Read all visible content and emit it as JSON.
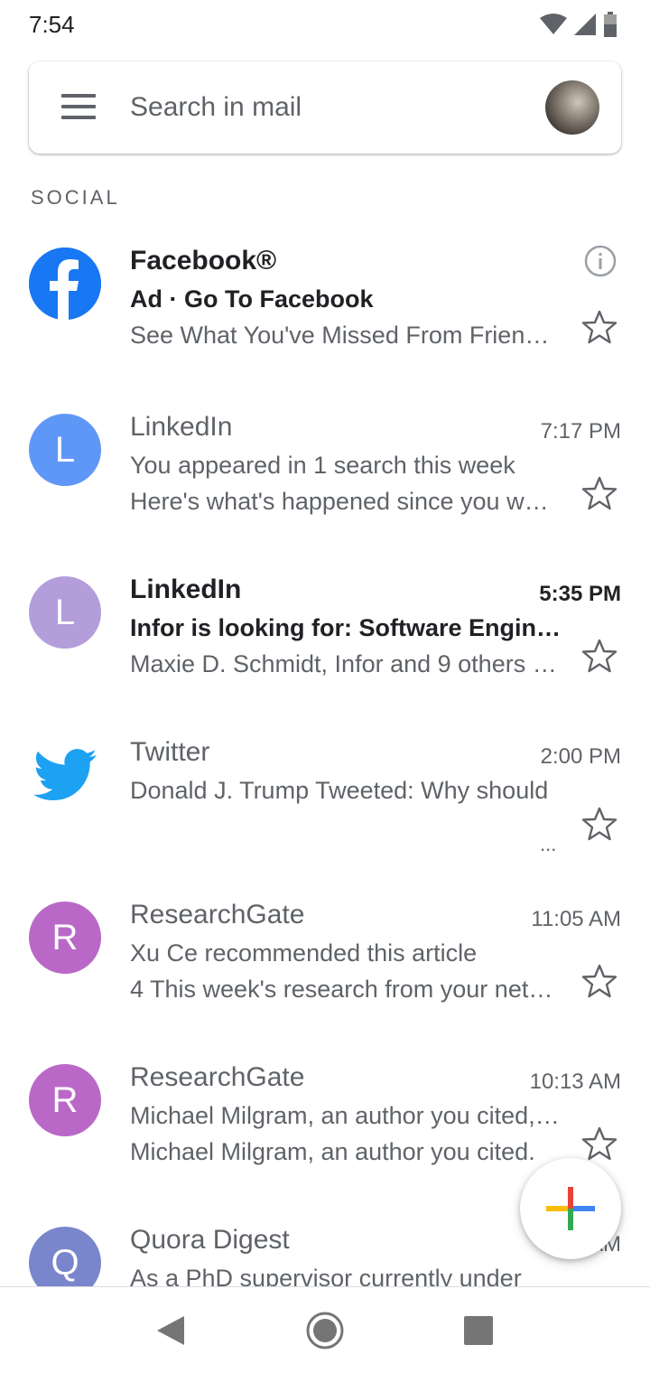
{
  "status_bar": {
    "time": "7:54",
    "icons": [
      "wifi-icon",
      "signal-icon",
      "battery-icon"
    ]
  },
  "search": {
    "placeholder": "Search in mail",
    "menu_icon": "menu-icon",
    "avatar_icon": "account-avatar"
  },
  "section": {
    "label": "SOCIAL"
  },
  "emails": [
    {
      "sender": "Facebook®",
      "subject": "Ad · Go To Facebook",
      "snippet": "See What You've Missed From Friends...",
      "avatar_kind": "facebook-logo",
      "unread": true,
      "ad": true
    },
    {
      "sender": "LinkedIn",
      "time": "7:17 PM",
      "subject": "You appeared in 1 search this week",
      "snippet": "Here's what's happened since you were away",
      "avatar_letter": "L",
      "avatar_color": "#5e97f6",
      "unread": false
    },
    {
      "sender": "LinkedIn",
      "time": "5:35 PM",
      "subject": "Infor is looking for: Software Engineer",
      "snippet": "Maxie D. Schmidt, Infor and 9 others share",
      "avatar_letter": "L",
      "avatar_color": "#b39ddb",
      "unread": true
    },
    {
      "sender": "Twitter",
      "time": "2:00 PM",
      "subject": "Donald J. Trump Tweeted: Why should",
      "snippet": "...",
      "avatar_kind": "twitter-logo",
      "unread": false
    },
    {
      "sender": "ResearchGate",
      "time": "11:05 AM",
      "subject": "Xu Ce recommended this article",
      "snippet": "4 This week's research from your network",
      "avatar_letter": "R",
      "avatar_color": "#ba68c8",
      "unread": false
    },
    {
      "sender": "ResearchGate",
      "time": "10:13 AM",
      "subject": "Michael Milgram, an author you cited, has",
      "snippet": "Michael Milgram, an author you cited.",
      "avatar_letter": "R",
      "avatar_color": "#ba68c8",
      "unread": false
    },
    {
      "sender": "Quora Digest",
      "time": "9:__ AM",
      "subject": "As a PhD supervisor currently under",
      "snippet": "",
      "avatar_letter": "Q",
      "avatar_color": "#7986cb",
      "unread": false
    }
  ],
  "colors": {
    "facebook": "#1877f2",
    "twitter": "#1da1f2",
    "fab_red": "#ea4335",
    "fab_blue": "#4285f4",
    "fab_yellow": "#fbbc04",
    "fab_green": "#34a853"
  },
  "fab": {
    "icon": "compose-plus-icon"
  },
  "nav": {
    "icons": [
      "back-icon",
      "home-icon",
      "recents-icon"
    ]
  }
}
